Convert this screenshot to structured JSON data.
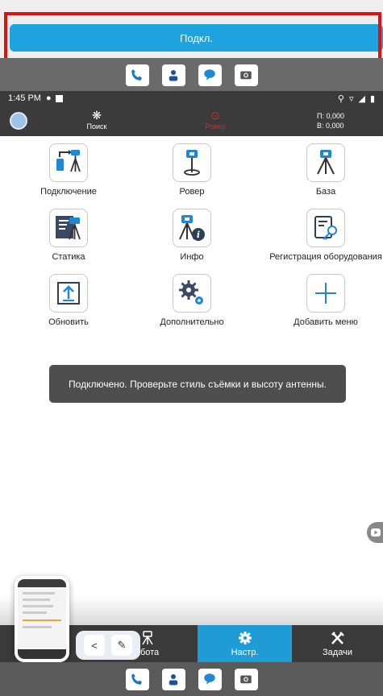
{
  "top": {
    "connect_label": "Подкл."
  },
  "status_bar": {
    "time": "1:45 PM"
  },
  "header": {
    "search_label": "Поиск",
    "rover_label": "Ровер",
    "coord_h": "П: 0,000",
    "coord_v": "В: 0,000"
  },
  "grid": [
    {
      "label": "Подключение",
      "icon": "connection-icon"
    },
    {
      "label": "Ровер",
      "icon": "rover-icon"
    },
    {
      "label": "База",
      "icon": "base-icon"
    },
    {
      "label": "Статика",
      "icon": "static-icon"
    },
    {
      "label": "Инфо",
      "icon": "info-icon"
    },
    {
      "label": "Регистрация оборудования",
      "icon": "registration-icon"
    },
    {
      "label": "Обновить",
      "icon": "update-icon"
    },
    {
      "label": "Дополнительно",
      "icon": "settings-more-icon"
    },
    {
      "label": "Добавить меню",
      "icon": "add-icon"
    }
  ],
  "toast": {
    "text": "Подключено. Проверьте стиль съёмки и высоту антенны."
  },
  "bottom_nav": [
    {
      "label": "Работа",
      "visible_label": "абота",
      "icon": "survey-pole-icon"
    },
    {
      "label": "Настр.",
      "icon": "gear-icon",
      "active": true
    },
    {
      "label": "Задачи",
      "icon": "tools-icon"
    }
  ],
  "colors": {
    "accent": "#1fa3df",
    "highlight": "#e01010",
    "dark": "#3b3b3b",
    "rover_red": "#cf2a2a"
  }
}
